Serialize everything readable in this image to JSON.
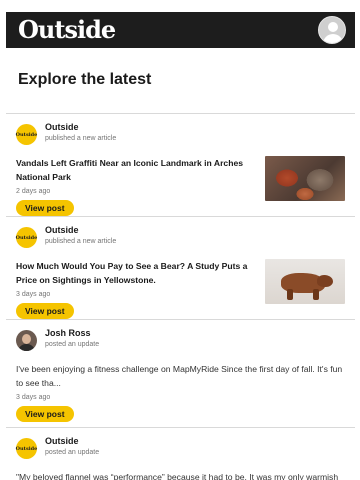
{
  "header": {
    "logo_text": "Outside",
    "colors": {
      "bar": "#1d1d1d",
      "accent": "#f5c400"
    },
    "profile_icon": "user-avatar-icon"
  },
  "page": {
    "title": "Explore the latest"
  },
  "feed": [
    {
      "author": "Outside",
      "action": "published a new article",
      "headline": "Vandals Left Graffiti Near an Iconic Landmark in Arches National Park",
      "time": "2 days ago",
      "button": "View post",
      "thumbnail": "rock-formation-image"
    },
    {
      "author": "Outside",
      "action": "published a new article",
      "headline": "How Much Would You Pay to See a Bear? A Study Puts a Price on Sightings in Yellowstone.",
      "time": "3 days ago",
      "button": "View post",
      "thumbnail": "grizzly-bear-image"
    },
    {
      "author": "Josh Ross",
      "action": "posted an update",
      "body": "I've been enjoying a fitness challenge on MapMyRide Since the first day of fall. It's fun to see tha...",
      "time": "3 days ago",
      "button": "View post"
    },
    {
      "author": "Outside",
      "action": "posted an update",
      "body": "\"My beloved flannel was “performance” because it had to be. It was my only warmish"
    }
  ],
  "brand_badge_text": "Outside"
}
